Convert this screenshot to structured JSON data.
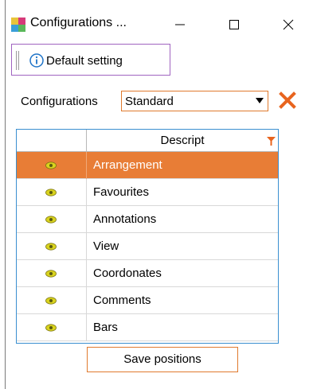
{
  "window": {
    "title": "Configurations ...",
    "controls": {
      "minimize": "minimize-icon",
      "maximize": "maximize-icon",
      "close": "close-icon"
    }
  },
  "toolbar": {
    "default_setting_label": "Default setting",
    "icon": "info-icon"
  },
  "configurations": {
    "label": "Configurations",
    "selected": "Standard",
    "delete_icon": "delete-x-icon"
  },
  "grid": {
    "header": {
      "description": "Descript",
      "filter_icon": "filter-icon"
    },
    "rows": [
      {
        "label": "Arrangement",
        "visible": true,
        "selected": true
      },
      {
        "label": "Favourites",
        "visible": true,
        "selected": false
      },
      {
        "label": "Annotations",
        "visible": true,
        "selected": false
      },
      {
        "label": "View",
        "visible": true,
        "selected": false
      },
      {
        "label": "Coordonates",
        "visible": true,
        "selected": false
      },
      {
        "label": "Comments",
        "visible": true,
        "selected": false
      },
      {
        "label": "Bars",
        "visible": true,
        "selected": false
      }
    ]
  },
  "footer": {
    "save_label": "Save positions"
  },
  "colors": {
    "accent": "#e87d36",
    "grid_border": "#3a8fd0",
    "toolbar_border": "#a064c0",
    "delete": "#e8641e"
  }
}
